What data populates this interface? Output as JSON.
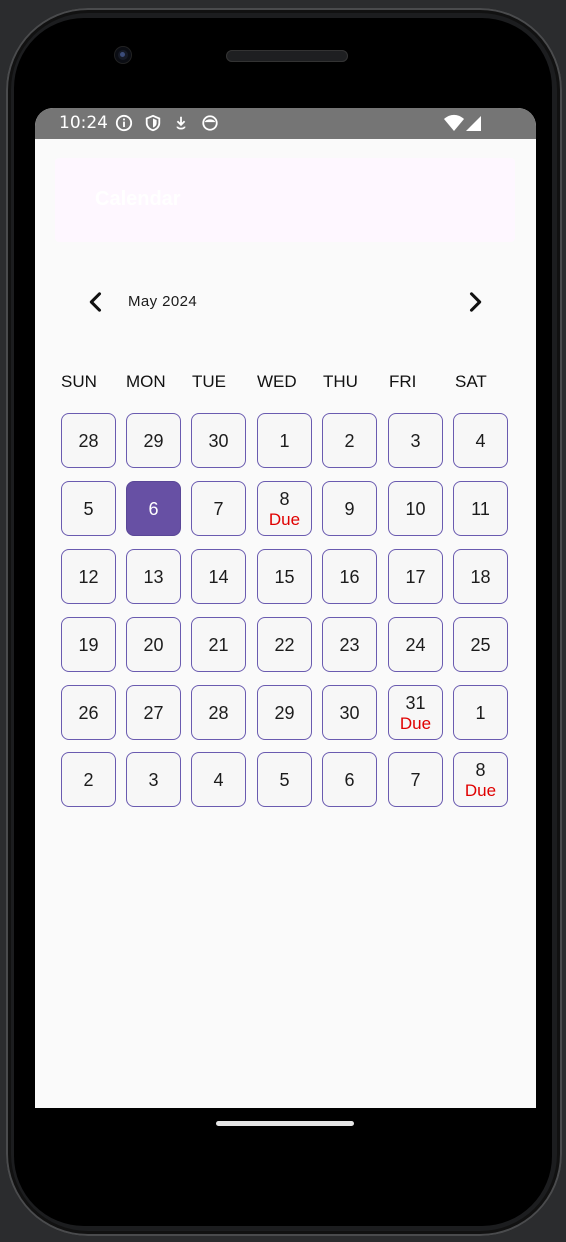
{
  "status_bar": {
    "time": "10:24",
    "icons": [
      "info-icon",
      "shield-icon",
      "download-icon",
      "face-icon"
    ],
    "right_icons": [
      "wifi-icon",
      "signal-icon"
    ]
  },
  "app_bar": {
    "title": "Calendar"
  },
  "calendar": {
    "month_label": "May 2024",
    "prev_icon": "chevron-left-icon",
    "next_icon": "chevron-right-icon",
    "weekdays": [
      "SUN",
      "MON",
      "TUE",
      "WED",
      "THU",
      "FRI",
      "SAT"
    ],
    "selected_day": "6",
    "due_label": "Due",
    "weeks": [
      [
        {
          "day": "28",
          "due": ""
        },
        {
          "day": "29",
          "due": ""
        },
        {
          "day": "30",
          "due": ""
        },
        {
          "day": "1",
          "due": ""
        },
        {
          "day": "2",
          "due": ""
        },
        {
          "day": "3",
          "due": ""
        },
        {
          "day": "4",
          "due": ""
        }
      ],
      [
        {
          "day": "5",
          "due": ""
        },
        {
          "day": "6",
          "due": "",
          "selected": true
        },
        {
          "day": "7",
          "due": ""
        },
        {
          "day": "8",
          "due": "Due"
        },
        {
          "day": "9",
          "due": ""
        },
        {
          "day": "10",
          "due": ""
        },
        {
          "day": "11",
          "due": ""
        }
      ],
      [
        {
          "day": "12",
          "due": ""
        },
        {
          "day": "13",
          "due": ""
        },
        {
          "day": "14",
          "due": ""
        },
        {
          "day": "15",
          "due": ""
        },
        {
          "day": "16",
          "due": ""
        },
        {
          "day": "17",
          "due": ""
        },
        {
          "day": "18",
          "due": ""
        }
      ],
      [
        {
          "day": "19",
          "due": ""
        },
        {
          "day": "20",
          "due": ""
        },
        {
          "day": "21",
          "due": ""
        },
        {
          "day": "22",
          "due": ""
        },
        {
          "day": "23",
          "due": ""
        },
        {
          "day": "24",
          "due": ""
        },
        {
          "day": "25",
          "due": ""
        }
      ],
      [
        {
          "day": "26",
          "due": ""
        },
        {
          "day": "27",
          "due": ""
        },
        {
          "day": "28",
          "due": ""
        },
        {
          "day": "29",
          "due": ""
        },
        {
          "day": "30",
          "due": ""
        },
        {
          "day": "31",
          "due": "Due"
        },
        {
          "day": "1",
          "due": ""
        }
      ],
      [
        {
          "day": "2",
          "due": ""
        },
        {
          "day": "3",
          "due": ""
        },
        {
          "day": "4",
          "due": ""
        },
        {
          "day": "5",
          "due": ""
        },
        {
          "day": "6",
          "due": ""
        },
        {
          "day": "7",
          "due": ""
        },
        {
          "day": "8",
          "due": "Due"
        }
      ]
    ]
  },
  "colors": {
    "accent": "#6750a4",
    "cell_border": "#6a5bb0",
    "due_text": "#e00000",
    "status_bar": "#757575",
    "app_bar": "#fef7ff",
    "screen_bg": "#fafafa"
  }
}
